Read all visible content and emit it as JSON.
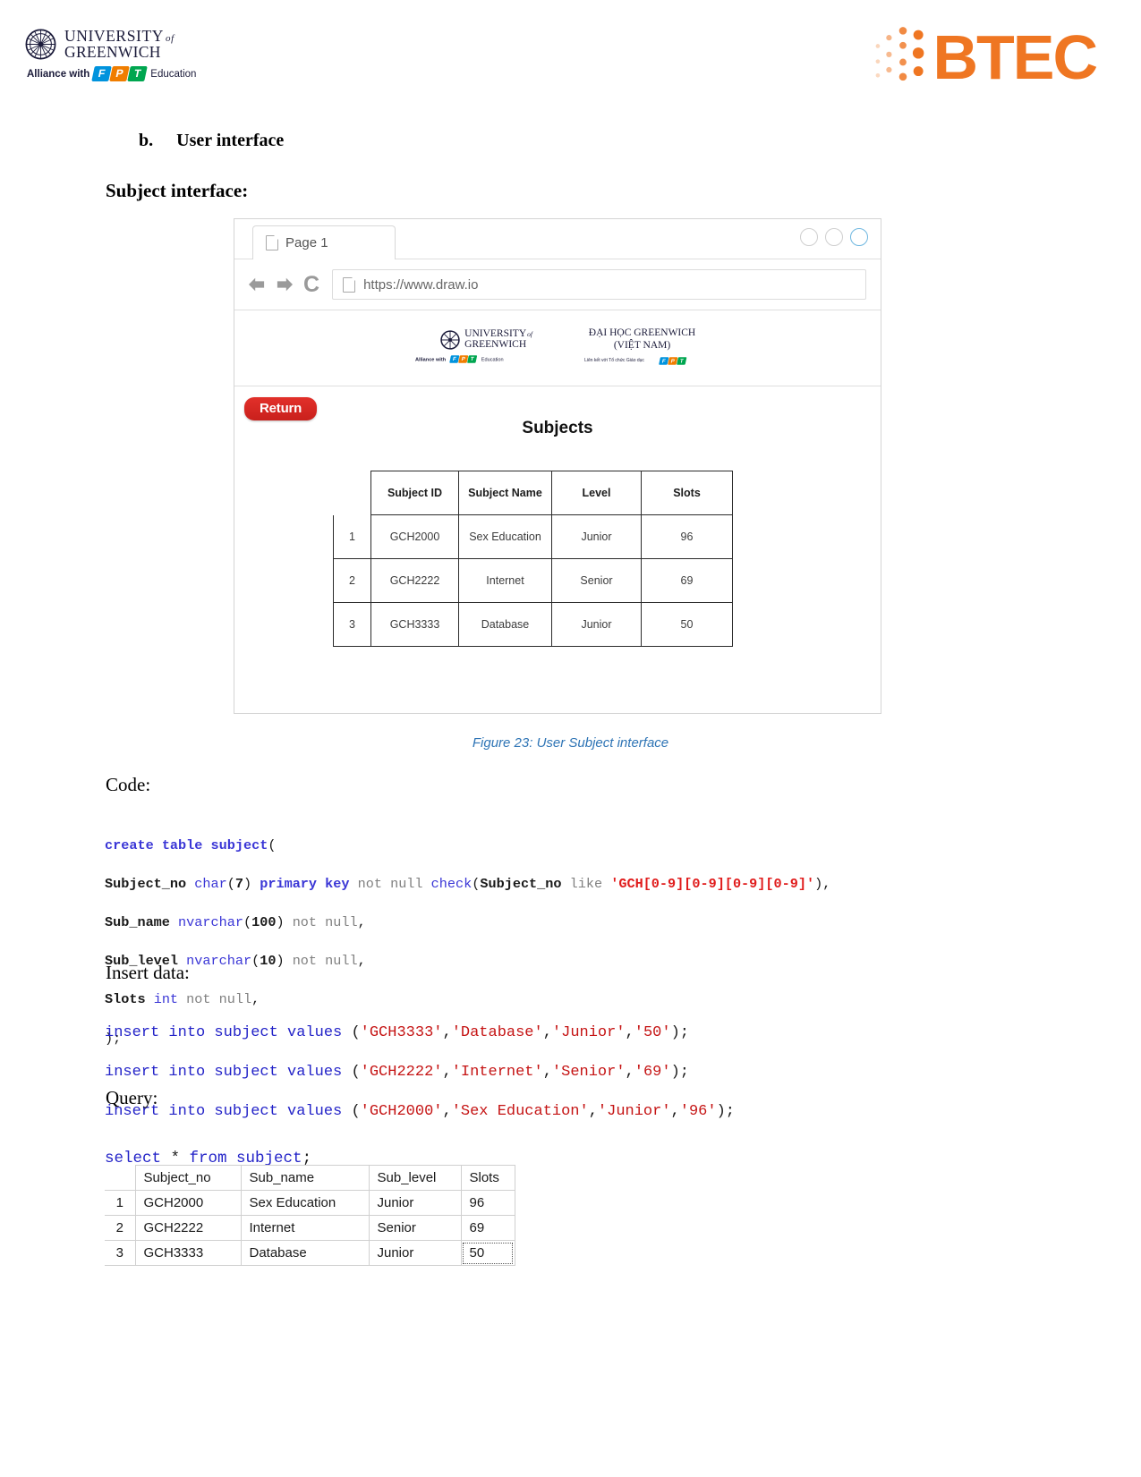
{
  "header": {
    "university": {
      "line1": "UNIVERSITY",
      "of": "of",
      "line2": "GREENWICH"
    },
    "alliance": {
      "prefix": "Alliance with",
      "fpt": [
        "F",
        "P",
        "T"
      ],
      "suffix": "Education"
    },
    "btec": {
      "text": "BTEC"
    }
  },
  "document": {
    "section_letter": "b.",
    "section_title": "User interface",
    "subsection_title": "Subject interface:",
    "figure_caption": "Figure 23: User Subject interface",
    "code_label": "Code:",
    "insert_label": "Insert data:",
    "query_label": "Query:"
  },
  "browser": {
    "tab_label": "Page 1",
    "url": "https://www.draw.io",
    "window_buttons": [
      "minimize-circle",
      "maximize-circle",
      "close-circle"
    ],
    "nav_icons": [
      "back-arrow",
      "forward-arrow",
      "reload"
    ],
    "banner": {
      "left": {
        "line1": "UNIVERSITY",
        "of": "of",
        "line2": "GREENWICH",
        "alliance_prefix": "Alliance with",
        "alliance_suffix": "Education"
      },
      "right": {
        "line1": "ĐẠI HỌC GREENWICH",
        "line2": "(VIỆT NAM)",
        "sub": "Liên kết với Tổ chức Giáo dục"
      }
    },
    "page": {
      "return_button": "Return",
      "title": "Subjects",
      "table": {
        "columns": [
          "Subject ID",
          "Subject Name",
          "Level",
          "Slots"
        ],
        "rows": [
          {
            "index": "1",
            "subject_id": "GCH2000",
            "subject_name": "Sex Education",
            "level": "Junior",
            "slots": "96"
          },
          {
            "index": "2",
            "subject_id": "GCH2222",
            "subject_name": "Internet",
            "level": "Senior",
            "slots": "69"
          },
          {
            "index": "3",
            "subject_id": "GCH3333",
            "subject_name": "Database",
            "level": "Junior",
            "slots": "50"
          }
        ]
      }
    }
  },
  "code": {
    "create_table": {
      "line1": {
        "kw1": "create",
        "kw2": "table",
        "kw3": "subject",
        "paren": "("
      },
      "line2": {
        "col": "Subject_no",
        "type": "char",
        "p1": "(",
        "size": "7",
        "p2": ")",
        "pk": "primary key",
        "notnull": "not null",
        "check": "check",
        "p3": "(",
        "col2": "Subject_no",
        "like": "like",
        "pattern": "'GCH[0-9][0-9][0-9][0-9]'",
        "p4": ")",
        "comma": ","
      },
      "line3": {
        "col": "Sub_name",
        "type": "nvarchar",
        "p1": "(",
        "size": "100",
        "p2": ")",
        "notnull": "not null",
        "comma": ","
      },
      "line4": {
        "col": "Sub_level",
        "type": "nvarchar",
        "p1": "(",
        "size": "10",
        "p2": ")",
        "notnull": "not null",
        "comma": ","
      },
      "line5": {
        "col": "Slots",
        "type": "int",
        "notnull": "not null",
        "comma": ","
      },
      "line6": ");"
    },
    "inserts": [
      {
        "kw": "insert into subject values",
        "open": " (",
        "v1": "'GCH3333'",
        "c1": ",",
        "v2": "'Database'",
        "c2": ",",
        "v3": "'Junior'",
        "c3": ",",
        "v4": "'50'",
        "close": ");"
      },
      {
        "kw": "insert into subject values",
        "open": " (",
        "v1": "'GCH2222'",
        "c1": ",",
        "v2": "'Internet'",
        "c2": ",",
        "v3": "'Senior'",
        "c3": ",",
        "v4": "'69'",
        "close": ");"
      },
      {
        "kw": "insert into subject values",
        "open": " (",
        "v1": "'GCH2000'",
        "c1": ",",
        "v2": "'Sex Education'",
        "c2": ",",
        "v3": "'Junior'",
        "c3": ",",
        "v4": "'96'",
        "close": ");"
      }
    ],
    "query": {
      "kw1": "select",
      "star": " * ",
      "kw2": "from subject",
      "semi": ";"
    }
  },
  "result_grid": {
    "columns": [
      "Subject_no",
      "Sub_name",
      "Sub_level",
      "Slots"
    ],
    "rows": [
      {
        "index": "1",
        "subject_no": "GCH2000",
        "sub_name": "Sex Education",
        "sub_level": "Junior",
        "slots": "96"
      },
      {
        "index": "2",
        "subject_no": "GCH2222",
        "sub_name": "Internet",
        "sub_level": "Senior",
        "slots": "69"
      },
      {
        "index": "3",
        "subject_no": "GCH3333",
        "sub_name": "Database",
        "sub_level": "Junior",
        "slots": "50"
      }
    ],
    "selected_cell": "50"
  },
  "colors": {
    "btec_orange": "#ef7622",
    "caption_blue": "#2e74b5",
    "return_red": "#d2241f",
    "sql_keyword": "#2323c8",
    "sql_string": "#c51414"
  }
}
